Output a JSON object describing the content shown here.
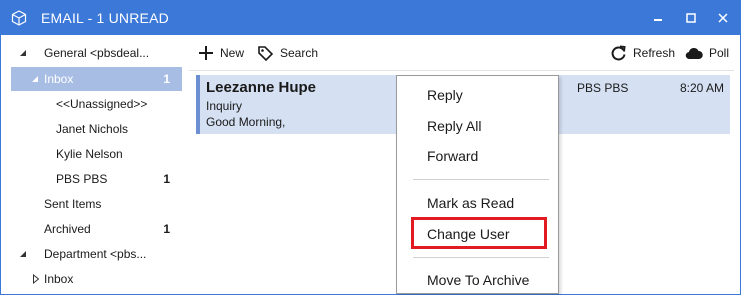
{
  "window": {
    "title": "EMAIL - 1 UNREAD",
    "minimize_glyph": "‒",
    "maximize_glyph": "□",
    "close_glyph": "✕"
  },
  "sidebar": {
    "items": [
      {
        "label": "General  <pbsdeal...",
        "count": "",
        "expanded": true
      },
      {
        "label": "Inbox",
        "count": "1",
        "expanded": true,
        "selected": true
      },
      {
        "label": "<<Unassigned>>",
        "count": ""
      },
      {
        "label": "Janet Nichols",
        "count": ""
      },
      {
        "label": "Kylie Nelson",
        "count": ""
      },
      {
        "label": "PBS PBS",
        "count": "1"
      },
      {
        "label": "Sent Items",
        "count": ""
      },
      {
        "label": "Archived",
        "count": "1"
      },
      {
        "label": "Department  <pbs...",
        "count": "",
        "expanded": true
      },
      {
        "label": "Inbox",
        "count": "",
        "expanded": false
      }
    ]
  },
  "toolbar": {
    "new_label": "New",
    "search_label": "Search",
    "refresh_label": "Refresh",
    "poll_label": "Poll"
  },
  "message": {
    "sender": "Leezanne Hupe",
    "subject": "Inquiry",
    "preview": "Good Morning,",
    "user": "PBS PBS",
    "time": "8:20 AM"
  },
  "context_menu": {
    "items": [
      "Reply",
      "Reply All",
      "Forward",
      "Mark as Read",
      "Change User",
      "Move To Archive"
    ],
    "highlighted": "Change User"
  },
  "colors": {
    "titlebar": "#3b78d8",
    "selection": "#a8bde4",
    "message_bg": "#d5e0f3",
    "highlight": "#e21b23"
  }
}
